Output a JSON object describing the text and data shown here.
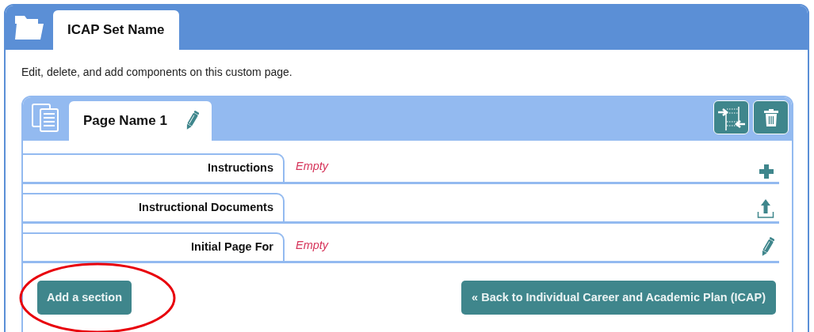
{
  "set_tab": {
    "label": "ICAP Set Name",
    "selected": true
  },
  "description": "Edit, delete, and add components on this custom page.",
  "page_tab": {
    "label": "Page Name 1",
    "selected": true
  },
  "sections": [
    {
      "label": "Instructions",
      "value": "Empty",
      "kind": "add"
    },
    {
      "label": "Instructional Documents",
      "kind": "upload"
    },
    {
      "label": "Initial Page For",
      "value": "Empty",
      "kind": "edit"
    }
  ],
  "add_button": "Add a section",
  "back_button": "« Back to Individual Career and Academic Plan (ICAP)",
  "highlight": true
}
